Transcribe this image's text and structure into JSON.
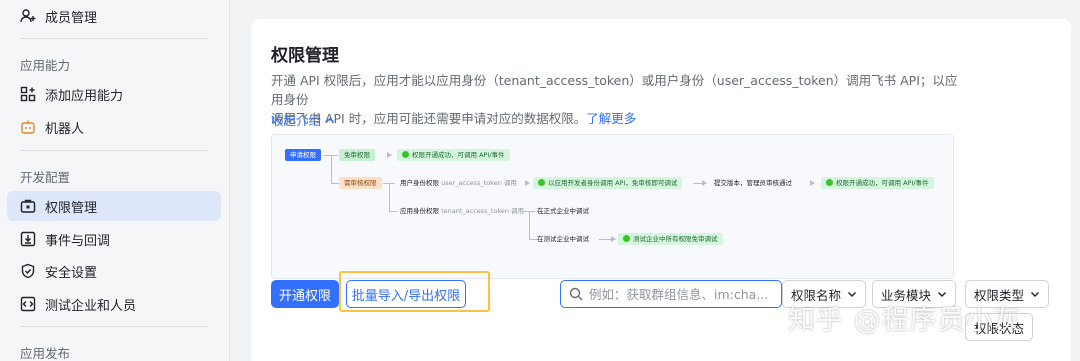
{
  "sidebar": {
    "member_item": "成员管理",
    "section_app_ability": "应用能力",
    "add_ability": "添加应用能力",
    "robot": "机器人",
    "section_dev_config": "开发配置",
    "permission_mgmt": "权限管理",
    "events_callbacks": "事件与回调",
    "security_settings": "安全设置",
    "test_company": "测试企业和人员",
    "section_release": "应用发布"
  },
  "main": {
    "title": "权限管理",
    "desc_line1": "开通 API 权限后，应用才能以应用身份（tenant_access_token）或用户身份（user_access_token）调用飞书 API；以应用身份",
    "desc_line2": "调用飞书 API 时，应用可能还需要申请对应的数据权限。",
    "learn_more": "了解更多",
    "collapse": "收起介绍"
  },
  "flow": {
    "apply": "申请权限",
    "no_review": "免审权限",
    "granted_1": "权限开通成功，可调用 API/事件",
    "need_review": "需审核权限",
    "user_identity": "用户身份权限",
    "user_token": "user_access_token 调用",
    "dev_identity": "以应用开发者身份调用 API，免审核即可调试",
    "submit": "提交版本，管理员审核通过",
    "granted_2": "权限开通成功，可调用 API/事件",
    "app_identity": "应用身份权限",
    "tenant_token": "tenant_access_token 调用",
    "prod_debug": "在正式企业中调试",
    "test_debug": "在测试企业中调试",
    "test_free": "测试企业中所有权限免审调试"
  },
  "toolbar": {
    "enable_btn": "开通权限",
    "batch_btn": "批量导入/导出权限",
    "search_placeholder": "例如：获取群组信息、im:cha...",
    "filter_name": "权限名称",
    "filter_module": "业务模块",
    "filter_type": "权限类型",
    "filter_status": "权限状态"
  },
  "watermark": "知乎 @程序员小灰",
  "colors": {
    "accent": "#3370ff",
    "highlight": "#f6c344"
  }
}
